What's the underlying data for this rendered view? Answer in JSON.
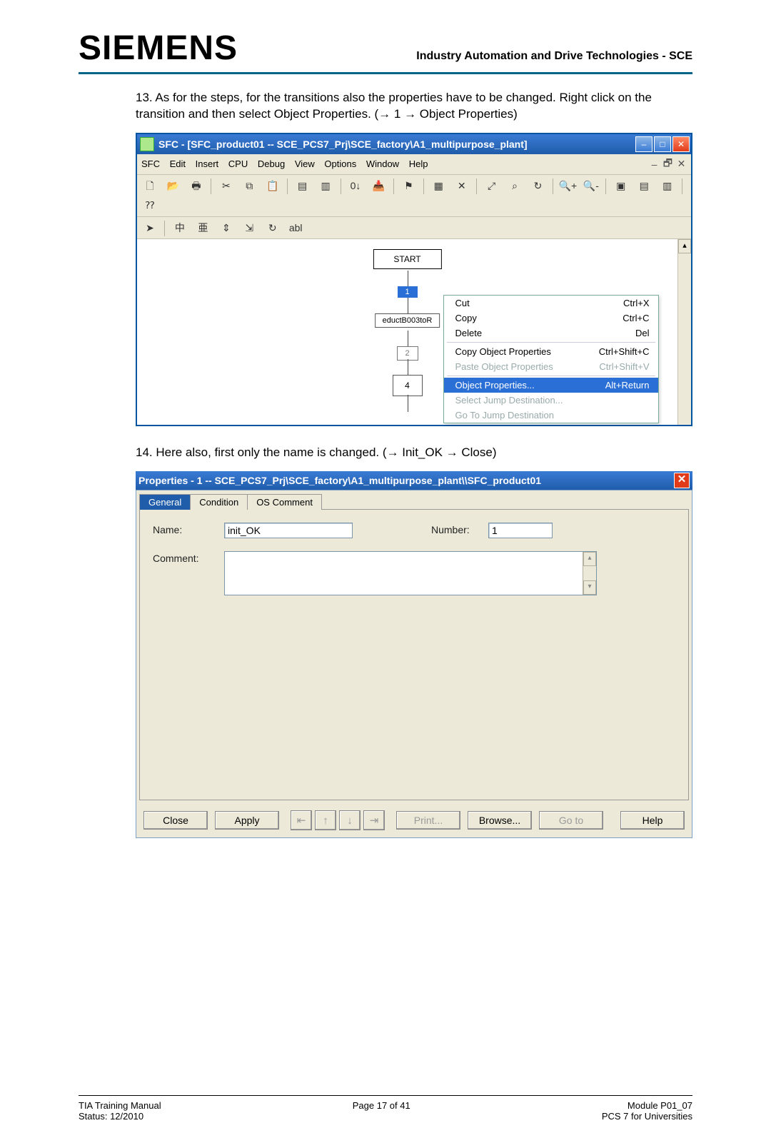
{
  "header": {
    "brand": "SIEMENS",
    "right": "Industry Automation and Drive Technologies - SCE"
  },
  "steps": {
    "s13": "13. As for the steps, for the transitions also the properties have to be changed. Right click on the transition and then select Object Properties. (→ 1 → Object Properties)",
    "s14": "14. Here also, first only the name is changed. (→ Init_OK → Close)"
  },
  "win1": {
    "title": "SFC - [SFC_product01 -- SCE_PCS7_Prj\\SCE_factory\\A1_multipurpose_plant]",
    "menus": [
      "SFC",
      "Edit",
      "Insert",
      "CPU",
      "Debug",
      "View",
      "Options",
      "Window",
      "Help"
    ],
    "sfc": {
      "start": "START",
      "trans1": "1",
      "step_name": "eductB003toR",
      "step2": "2",
      "step4": "4"
    },
    "context_menu": [
      {
        "label": "Cut",
        "shortcut": "Ctrl+X",
        "state": "normal"
      },
      {
        "label": "Copy",
        "shortcut": "Ctrl+C",
        "state": "normal"
      },
      {
        "label": "Delete",
        "shortcut": "Del",
        "state": "normal"
      },
      {
        "sep": true
      },
      {
        "label": "Copy Object Properties",
        "shortcut": "Ctrl+Shift+C",
        "state": "normal"
      },
      {
        "label": "Paste Object Properties",
        "shortcut": "Ctrl+Shift+V",
        "state": "disabled"
      },
      {
        "sep": true
      },
      {
        "label": "Object Properties...",
        "shortcut": "Alt+Return",
        "state": "highlight"
      },
      {
        "label": "Select Jump Destination...",
        "shortcut": "",
        "state": "disabled"
      },
      {
        "label": "Go To Jump Destination",
        "shortcut": "",
        "state": "disabled"
      }
    ]
  },
  "win2": {
    "title": "Properties -  1 -- SCE_PCS7_Prj\\SCE_factory\\A1_multipurpose_plant\\\\SFC_product01",
    "tabs": {
      "general": "General",
      "condition": "Condition",
      "os": "OS Comment"
    },
    "labels": {
      "name": "Name:",
      "number": "Number:",
      "comment": "Comment:"
    },
    "values": {
      "name": "init_OK",
      "number": "1",
      "comment": ""
    },
    "buttons": {
      "close": "Close",
      "apply": "Apply",
      "print": "Print...",
      "browse": "Browse...",
      "goto": "Go to",
      "help": "Help"
    }
  },
  "footer": {
    "left1": "TIA Training Manual",
    "left2": "Status: 12/2010",
    "mid": "Page 17 of 41",
    "right1": "Module P01_07",
    "right2": "PCS 7 for Universities"
  }
}
